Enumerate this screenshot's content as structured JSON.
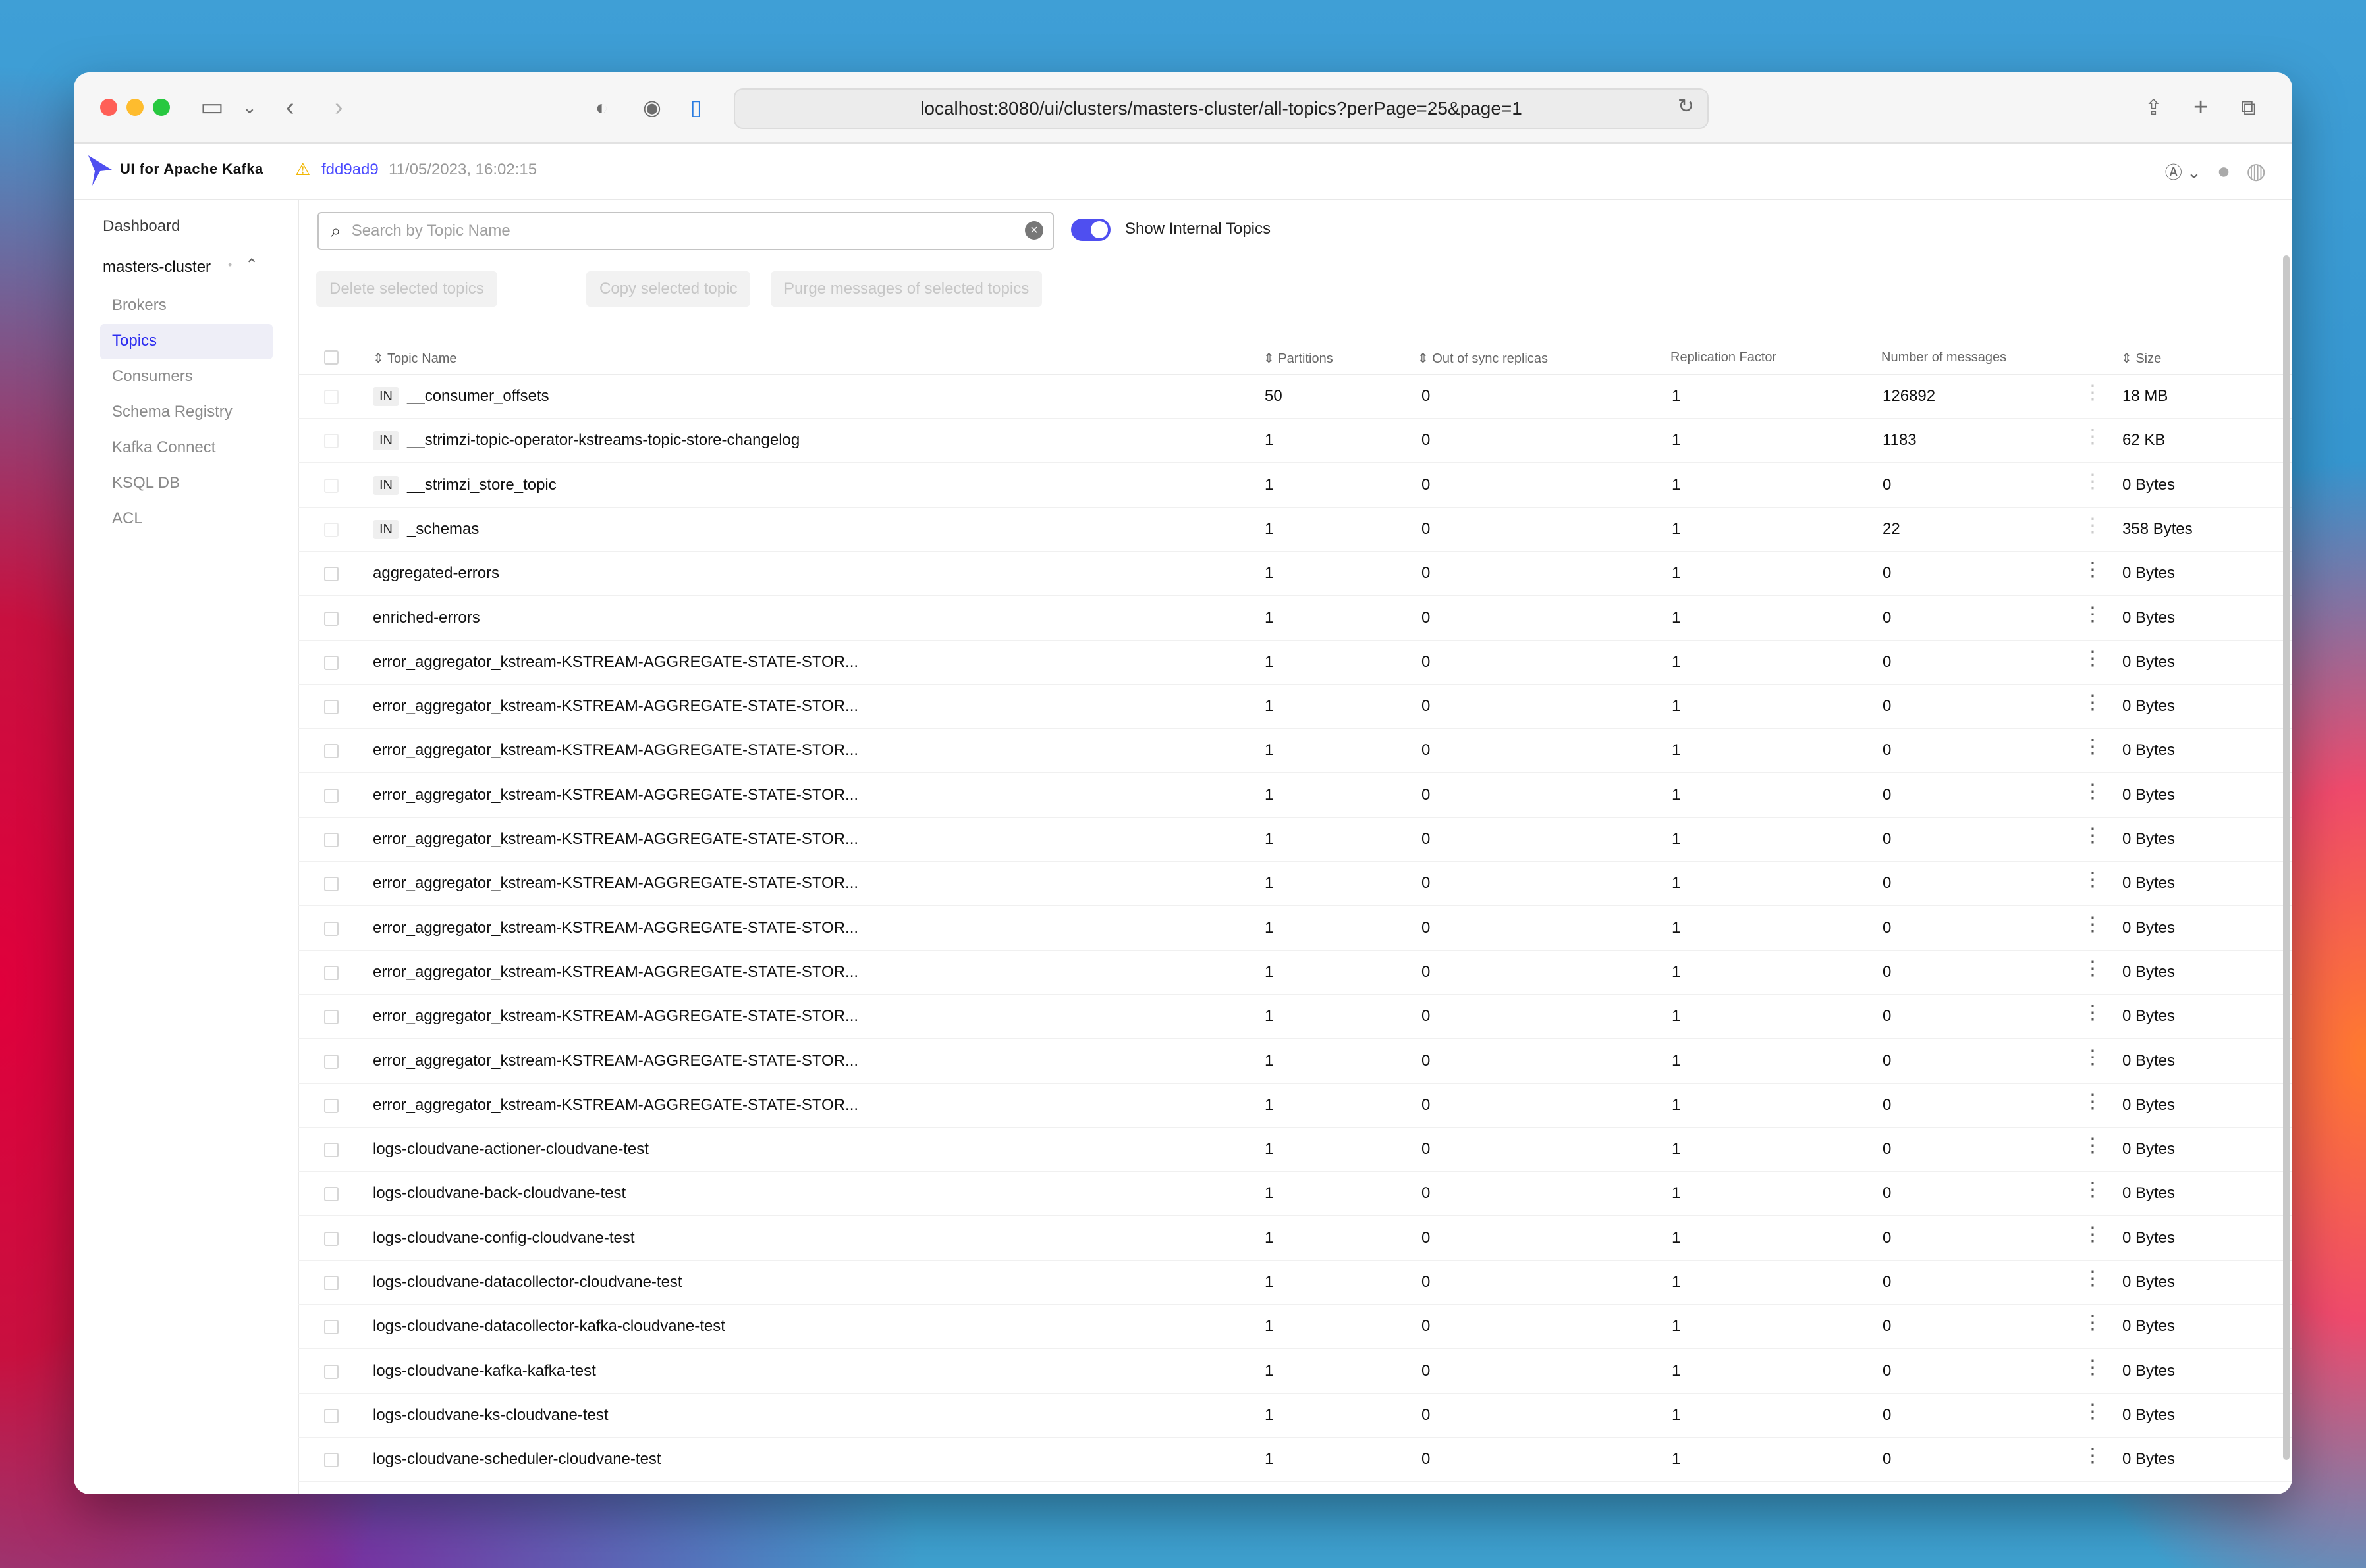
{
  "browser": {
    "url": "localhost:8080/ui/clusters/masters-cluster/all-topics?perPage=25&page=1"
  },
  "app": {
    "brand": "UI for Apache Kafka",
    "commit": "fdd9ad9",
    "commit_date": "11/05/2023, 16:02:15",
    "accent_color": "#4f4ff0"
  },
  "sidebar": {
    "dashboard": "Dashboard",
    "cluster": "masters-cluster",
    "items": [
      "Brokers",
      "Topics",
      "Consumers",
      "Schema Registry",
      "Kafka Connect",
      "KSQL DB",
      "ACL"
    ],
    "active": "Topics"
  },
  "toolbar": {
    "search_placeholder": "Search by Topic Name",
    "toggle_label": "Show Internal Topics",
    "delete_label": "Delete selected topics",
    "copy_label": "Copy selected topic",
    "purge_label": "Purge messages of selected topics"
  },
  "table": {
    "headers": [
      "Topic Name",
      "Partitions",
      "Out of sync replicas",
      "Replication Factor",
      "Number of messages",
      "Size"
    ],
    "rows": [
      {
        "internal": "IN",
        "name": "__consumer_offsets",
        "partitions": "50",
        "oos": "0",
        "rf": "1",
        "messages": "126892",
        "size": "18 MB"
      },
      {
        "internal": "IN",
        "name": "__strimzi-topic-operator-kstreams-topic-store-changelog",
        "partitions": "1",
        "oos": "0",
        "rf": "1",
        "messages": "1183",
        "size": "62 KB"
      },
      {
        "internal": "IN",
        "name": "__strimzi_store_topic",
        "partitions": "1",
        "oos": "0",
        "rf": "1",
        "messages": "0",
        "size": "0 Bytes"
      },
      {
        "internal": "IN",
        "name": "_schemas",
        "partitions": "1",
        "oos": "0",
        "rf": "1",
        "messages": "22",
        "size": "358 Bytes"
      },
      {
        "internal": "",
        "name": "aggregated-errors",
        "partitions": "1",
        "oos": "0",
        "rf": "1",
        "messages": "0",
        "size": "0 Bytes"
      },
      {
        "internal": "",
        "name": "enriched-errors",
        "partitions": "1",
        "oos": "0",
        "rf": "1",
        "messages": "0",
        "size": "0 Bytes"
      },
      {
        "internal": "",
        "name": "error_aggregator_kstream-KSTREAM-AGGREGATE-STATE-STOR...",
        "partitions": "1",
        "oos": "0",
        "rf": "1",
        "messages": "0",
        "size": "0 Bytes"
      },
      {
        "internal": "",
        "name": "error_aggregator_kstream-KSTREAM-AGGREGATE-STATE-STOR...",
        "partitions": "1",
        "oos": "0",
        "rf": "1",
        "messages": "0",
        "size": "0 Bytes"
      },
      {
        "internal": "",
        "name": "error_aggregator_kstream-KSTREAM-AGGREGATE-STATE-STOR...",
        "partitions": "1",
        "oos": "0",
        "rf": "1",
        "messages": "0",
        "size": "0 Bytes"
      },
      {
        "internal": "",
        "name": "error_aggregator_kstream-KSTREAM-AGGREGATE-STATE-STOR...",
        "partitions": "1",
        "oos": "0",
        "rf": "1",
        "messages": "0",
        "size": "0 Bytes"
      },
      {
        "internal": "",
        "name": "error_aggregator_kstream-KSTREAM-AGGREGATE-STATE-STOR...",
        "partitions": "1",
        "oos": "0",
        "rf": "1",
        "messages": "0",
        "size": "0 Bytes"
      },
      {
        "internal": "",
        "name": "error_aggregator_kstream-KSTREAM-AGGREGATE-STATE-STOR...",
        "partitions": "1",
        "oos": "0",
        "rf": "1",
        "messages": "0",
        "size": "0 Bytes"
      },
      {
        "internal": "",
        "name": "error_aggregator_kstream-KSTREAM-AGGREGATE-STATE-STOR...",
        "partitions": "1",
        "oos": "0",
        "rf": "1",
        "messages": "0",
        "size": "0 Bytes"
      },
      {
        "internal": "",
        "name": "error_aggregator_kstream-KSTREAM-AGGREGATE-STATE-STOR...",
        "partitions": "1",
        "oos": "0",
        "rf": "1",
        "messages": "0",
        "size": "0 Bytes"
      },
      {
        "internal": "",
        "name": "error_aggregator_kstream-KSTREAM-AGGREGATE-STATE-STOR...",
        "partitions": "1",
        "oos": "0",
        "rf": "1",
        "messages": "0",
        "size": "0 Bytes"
      },
      {
        "internal": "",
        "name": "error_aggregator_kstream-KSTREAM-AGGREGATE-STATE-STOR...",
        "partitions": "1",
        "oos": "0",
        "rf": "1",
        "messages": "0",
        "size": "0 Bytes"
      },
      {
        "internal": "",
        "name": "error_aggregator_kstream-KSTREAM-AGGREGATE-STATE-STOR...",
        "partitions": "1",
        "oos": "0",
        "rf": "1",
        "messages": "0",
        "size": "0 Bytes"
      },
      {
        "internal": "",
        "name": "logs-cloudvane-actioner-cloudvane-test",
        "partitions": "1",
        "oos": "0",
        "rf": "1",
        "messages": "0",
        "size": "0 Bytes"
      },
      {
        "internal": "",
        "name": "logs-cloudvane-back-cloudvane-test",
        "partitions": "1",
        "oos": "0",
        "rf": "1",
        "messages": "0",
        "size": "0 Bytes"
      },
      {
        "internal": "",
        "name": "logs-cloudvane-config-cloudvane-test",
        "partitions": "1",
        "oos": "0",
        "rf": "1",
        "messages": "0",
        "size": "0 Bytes"
      },
      {
        "internal": "",
        "name": "logs-cloudvane-datacollector-cloudvane-test",
        "partitions": "1",
        "oos": "0",
        "rf": "1",
        "messages": "0",
        "size": "0 Bytes"
      },
      {
        "internal": "",
        "name": "logs-cloudvane-datacollector-kafka-cloudvane-test",
        "partitions": "1",
        "oos": "0",
        "rf": "1",
        "messages": "0",
        "size": "0 Bytes"
      },
      {
        "internal": "",
        "name": "logs-cloudvane-kafka-kafka-test",
        "partitions": "1",
        "oos": "0",
        "rf": "1",
        "messages": "0",
        "size": "0 Bytes"
      },
      {
        "internal": "",
        "name": "logs-cloudvane-ks-cloudvane-test",
        "partitions": "1",
        "oos": "0",
        "rf": "1",
        "messages": "0",
        "size": "0 Bytes"
      },
      {
        "internal": "",
        "name": "logs-cloudvane-scheduler-cloudvane-test",
        "partitions": "1",
        "oos": "0",
        "rf": "1",
        "messages": "0",
        "size": "0 Bytes"
      }
    ]
  }
}
